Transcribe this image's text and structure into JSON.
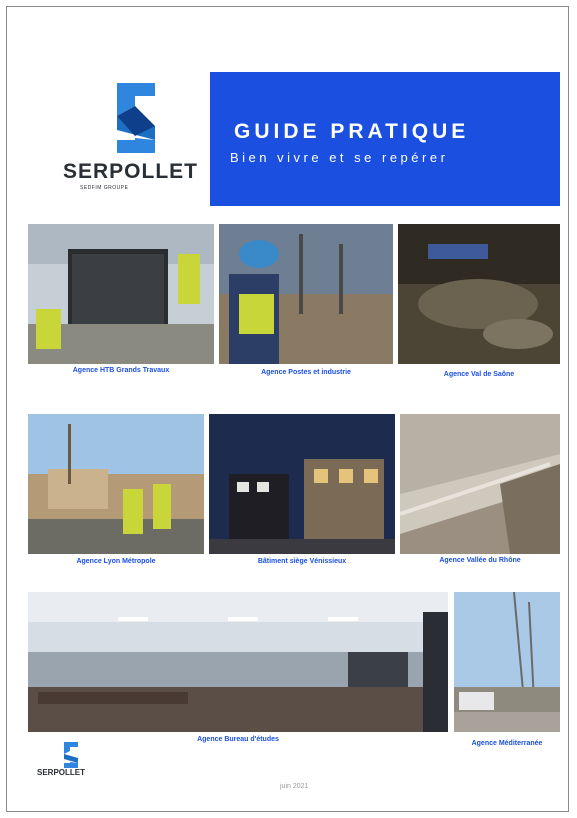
{
  "header": {
    "logo_name": "SERPOLLET",
    "logo_sub": "SEDFIM GROUPE",
    "title": "GUIDE PRATIQUE",
    "subtitle": "Bien vivre et se repérer"
  },
  "photos": [
    {
      "caption": "Agence HTB Grands Travaux"
    },
    {
      "caption": "Agence Postes et industrie"
    },
    {
      "caption": "Agence Val de Saône"
    },
    {
      "caption": "Agence Lyon Métropole"
    },
    {
      "caption": "Bâtiment siège Vénissieux"
    },
    {
      "caption": "Agence Vallée du Rhône"
    },
    {
      "caption": "Agence Bureau d'études"
    },
    {
      "caption": "Agence Méditerranée"
    }
  ],
  "footer": {
    "logo_name": "SERPOLLET",
    "date": "juin 2021"
  },
  "colors": {
    "brand_blue": "#1a4fe0",
    "logo_blue": "#2e86de"
  }
}
